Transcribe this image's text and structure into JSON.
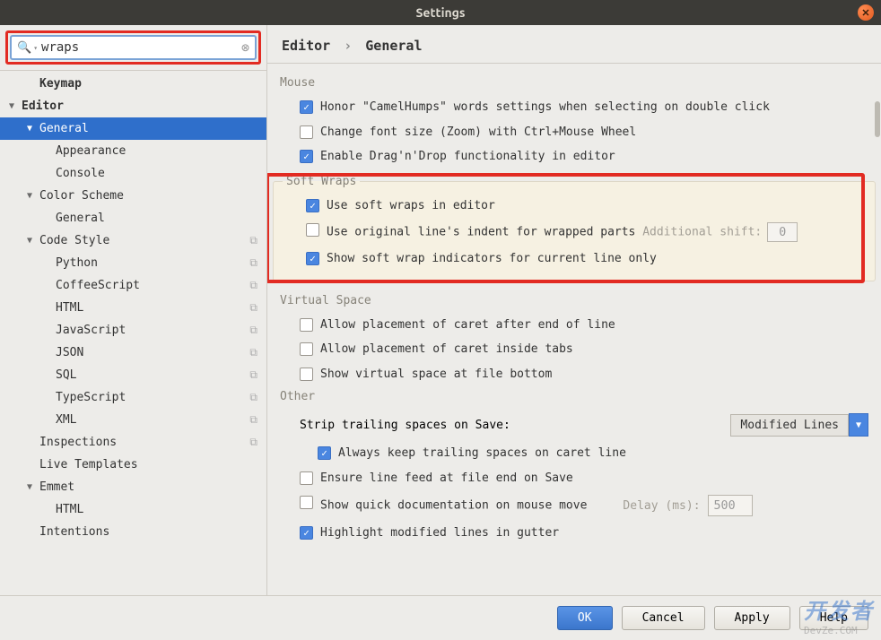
{
  "title": "Settings",
  "search": {
    "value": "wraps"
  },
  "tree": [
    {
      "label": "Keymap",
      "indent": 1,
      "bold": true
    },
    {
      "label": "Editor",
      "indent": 0,
      "bold": true,
      "arrow": "▼"
    },
    {
      "label": "General",
      "indent": 1,
      "arrow": "▼",
      "selected": true
    },
    {
      "label": "Appearance",
      "indent": 2
    },
    {
      "label": "Console",
      "indent": 2
    },
    {
      "label": "Color Scheme",
      "indent": 1,
      "arrow": "▼"
    },
    {
      "label": "General",
      "indent": 2
    },
    {
      "label": "Code Style",
      "indent": 1,
      "arrow": "▼",
      "copy": true
    },
    {
      "label": "Python",
      "indent": 2,
      "copy": true
    },
    {
      "label": "CoffeeScript",
      "indent": 2,
      "copy": true
    },
    {
      "label": "HTML",
      "indent": 2,
      "copy": true
    },
    {
      "label": "JavaScript",
      "indent": 2,
      "copy": true
    },
    {
      "label": "JSON",
      "indent": 2,
      "copy": true
    },
    {
      "label": "SQL",
      "indent": 2,
      "copy": true
    },
    {
      "label": "TypeScript",
      "indent": 2,
      "copy": true
    },
    {
      "label": "XML",
      "indent": 2,
      "copy": true
    },
    {
      "label": "Inspections",
      "indent": 1,
      "copy": true
    },
    {
      "label": "Live Templates",
      "indent": 1
    },
    {
      "label": "Emmet",
      "indent": 1,
      "arrow": "▼"
    },
    {
      "label": "HTML",
      "indent": 2
    },
    {
      "label": "Intentions",
      "indent": 1
    }
  ],
  "breadcrumb": {
    "a": "Editor",
    "b": "General"
  },
  "sections": {
    "mouse": {
      "title": "Mouse",
      "items": [
        {
          "checked": true,
          "label": "Honor \"CamelHumps\" words settings when selecting on double click"
        },
        {
          "checked": false,
          "label": "Change font size (Zoom) with Ctrl+Mouse Wheel"
        },
        {
          "checked": true,
          "label": "Enable Drag'n'Drop functionality in editor"
        }
      ]
    },
    "softwraps": {
      "title": "Soft Wraps",
      "items": [
        {
          "checked": true,
          "label": "Use soft wraps in editor"
        },
        {
          "checked": false,
          "label": "Use original line's indent for wrapped parts",
          "extra_label": "Additional shift:",
          "extra_value": "0"
        },
        {
          "checked": true,
          "label": "Show soft wrap indicators for current line only"
        }
      ]
    },
    "virtual": {
      "title": "Virtual Space",
      "items": [
        {
          "checked": false,
          "label": "Allow placement of caret after end of line"
        },
        {
          "checked": false,
          "label": "Allow placement of caret inside tabs"
        },
        {
          "checked": false,
          "label": "Show virtual space at file bottom"
        }
      ]
    },
    "other": {
      "title": "Other",
      "strip_label": "Strip trailing spaces on Save:",
      "strip_value": "Modified Lines",
      "items": [
        {
          "checked": true,
          "label": "Always keep trailing spaces on caret line",
          "indent": true
        },
        {
          "checked": false,
          "label": "Ensure line feed at file end on Save"
        },
        {
          "checked": false,
          "label": "Show quick documentation on mouse move",
          "delay_label": "Delay (ms):",
          "delay_value": "500"
        },
        {
          "checked": true,
          "label": "Highlight modified lines in gutter"
        }
      ]
    }
  },
  "buttons": {
    "ok": "OK",
    "cancel": "Cancel",
    "apply": "Apply",
    "help": "Help"
  },
  "watermark": {
    "main": "开发者",
    "sub": "DevZe.COM"
  }
}
